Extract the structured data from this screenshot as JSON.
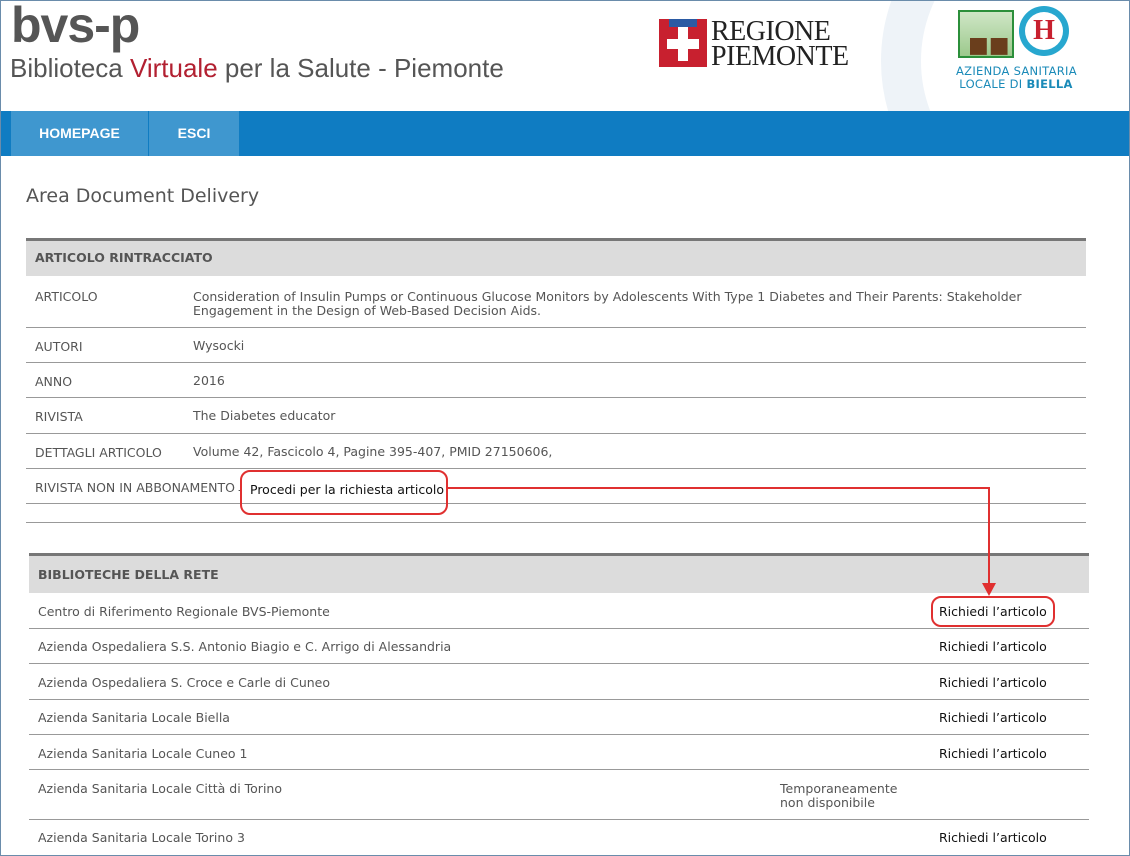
{
  "header": {
    "logo_main": "bvs-p",
    "logo_sub_before": "Biblioteca ",
    "logo_sub_accent": "Virtuale",
    "logo_sub_after": " per la Salute - Piemonte",
    "regione_line1": "REGIONE",
    "regione_line2": "PIEMONTE",
    "asl_line1": "AZIENDA SANITARIA",
    "asl_line2_a": "LOCALE DI ",
    "asl_line2_b": "BIELLA",
    "asl_badge_letter": "H"
  },
  "nav": {
    "items": [
      {
        "label": "HOMEPAGE"
      },
      {
        "label": "ESCI"
      }
    ]
  },
  "page": {
    "title": "Area Document Delivery"
  },
  "articolo": {
    "heading": "ARTICOLO RINTRACCIATO",
    "rows": [
      {
        "key": "ARTICOLO",
        "value": "Consideration of Insulin Pumps or Continuous Glucose Monitors by Adolescents With Type 1 Diabetes and Their Parents: Stakeholder Engagement in the Design of Web-Based Decision Aids."
      },
      {
        "key": "AUTORI",
        "value": "Wysocki"
      },
      {
        "key": "ANNO",
        "value": "2016"
      },
      {
        "key": "RIVISTA",
        "value": "The Diabetes educator"
      },
      {
        "key": "DETTAGLI ARTICOLO",
        "value": "Volume 42, Fascicolo 4, Pagine 395-407, PMID 27150606,"
      },
      {
        "key": "RIVISTA NON IN ABBONAMENTO",
        "value": "-"
      }
    ],
    "procedi_link": "Procedi per la richiesta articolo"
  },
  "biblioteche": {
    "heading": "BIBLIOTECHE DELLA RETE",
    "rows": [
      {
        "name": "Centro di Riferimento Regionale BVS-Piemonte",
        "action": "Richiedi l’articolo"
      },
      {
        "name": "Azienda Ospedaliera S.S. Antonio Biagio e C. Arrigo di Alessandria",
        "action": "Richiedi l’articolo"
      },
      {
        "name": "Azienda Ospedaliera S. Croce e Carle di Cuneo",
        "action": "Richiedi l’articolo"
      },
      {
        "name": "Azienda Sanitaria Locale Biella",
        "action": "Richiedi l’articolo"
      },
      {
        "name": "Azienda Sanitaria Locale Cuneo 1",
        "action": "Richiedi l’articolo"
      },
      {
        "name": "Azienda Sanitaria Locale Città di Torino",
        "status_line1": "Temporaneamente",
        "status_line2": "non disponibile"
      },
      {
        "name": "Azienda Sanitaria Locale Torino 3",
        "action": "Richiedi l’articolo"
      }
    ]
  },
  "colors": {
    "nav_bar": "#0f7cc2",
    "nav_item": "#3f97cf",
    "accent_red": "#b22031",
    "annotation_red": "#e03030",
    "section_header_bg": "#dcdcdc"
  }
}
